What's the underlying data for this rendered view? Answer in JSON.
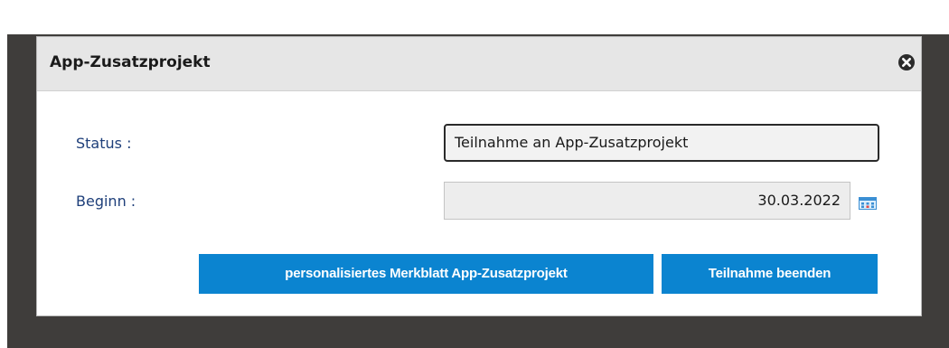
{
  "dialog": {
    "title": "App-Zusatzprojekt",
    "close_icon": "close-circle-icon"
  },
  "form": {
    "status_label": "Status :",
    "status_value": "Teilnahme an App-Zusatzprojekt",
    "beginn_label": "Beginn :",
    "beginn_value": "30.03.2022",
    "calendar_icon": "calendar-icon"
  },
  "buttons": {
    "merkblatt_label": "personalisiertes Merkblatt App-Zusatzprojekt",
    "beenden_label": "Teilnahme beenden"
  },
  "colors": {
    "button_bg": "#0b84d0",
    "label_text": "#1e3f7a",
    "backdrop": "#3f3d3b"
  }
}
